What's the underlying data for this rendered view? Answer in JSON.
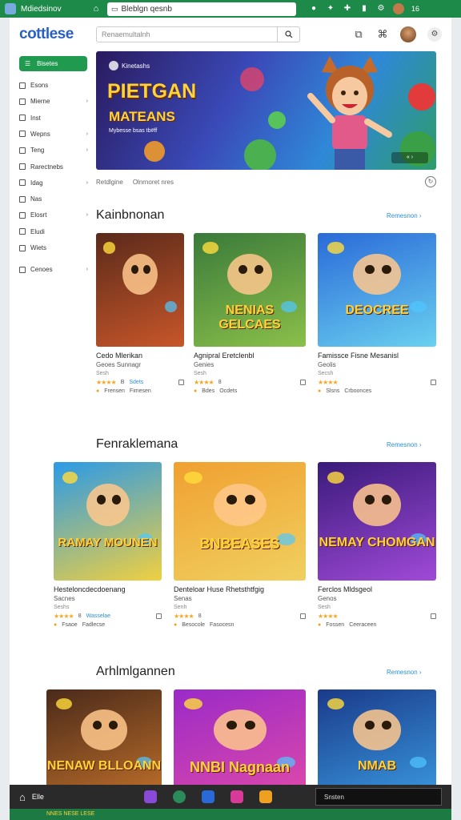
{
  "statusbar": {
    "app": "Mdiedsinov",
    "url": "Bleblgn qesnb",
    "time": "16"
  },
  "header": {
    "logo": "cottlese",
    "search_placeholder": "Renaemultalnh"
  },
  "sidebar": {
    "active": "Bisetes",
    "items": [
      {
        "label": "Esons",
        "chevron": false
      },
      {
        "label": "Mierne",
        "chevron": true
      },
      {
        "label": "Inst",
        "chevron": false
      },
      {
        "label": "Wepns",
        "chevron": true
      },
      {
        "label": "Teng",
        "chevron": true
      },
      {
        "label": "Rarectnebs",
        "chevron": false
      },
      {
        "label": "Idag",
        "chevron": true
      },
      {
        "label": "Nas",
        "chevron": false
      },
      {
        "label": "Elosrt",
        "chevron": true
      },
      {
        "label": "Eludi",
        "chevron": false
      },
      {
        "label": "Wiets",
        "chevron": false
      },
      {
        "label": "Cenoes",
        "chevron": true
      }
    ]
  },
  "hero": {
    "brand": "Kinetashs",
    "title": "PIETGAN",
    "subtitle": "MATEANS",
    "tagline": "Mybesse bsas tb#ff",
    "controls": "« ›",
    "caption_left": "Retdlgine",
    "caption_right": "Olnrnoret nres"
  },
  "sections": [
    {
      "title": "Kainbnonan",
      "link": "Remesnon ›",
      "cards": [
        {
          "title": "Cedo Mlerikan",
          "sub": "Geoes Sunnagr",
          "meta": "Sesh",
          "rating": "B",
          "extra": "Sdets",
          "foot1": "Frensen",
          "foot2": "Fimesen",
          "img_text": ""
        },
        {
          "title": "Agnipral Eretclenbl",
          "sub": "Genies",
          "meta": "Sesh",
          "rating": "8",
          "extra": "",
          "foot1": "Bdes",
          "foot2": "Ocdets",
          "img_text": "NENIAS GELCAES"
        },
        {
          "title": "Famissce Fisne Mesanisl",
          "sub": "Geolis",
          "meta": "Secsh",
          "rating": "",
          "extra": "",
          "foot1": "Slsns",
          "foot2": "Crboonces",
          "img_text": "DEOCREE"
        }
      ]
    },
    {
      "title": "Fenraklemana",
      "link": "Remesnon ›",
      "cards": [
        {
          "title": "Hesteloncdecdoenang",
          "sub": "Sacnes",
          "meta": "Seshs",
          "rating": "8",
          "extra": "Wasselae",
          "foot1": "Fsaoe",
          "foot2": "Fadlecse",
          "img_text": "RAMAY MOUNEN"
        },
        {
          "title": "Denteloar Huse Rhetsthtfgig",
          "sub": "Senas",
          "meta": "Senh",
          "rating": "8",
          "extra": "",
          "foot1": "Besocole",
          "foot2": "Fasocesn",
          "img_text": "BNBEASES"
        },
        {
          "title": "Ferclos Mldsgeol",
          "sub": "Genos",
          "meta": "Sesh",
          "rating": "",
          "extra": "",
          "foot1": "Fossen",
          "foot2": "Ceeraceen",
          "img_text": "NEMAY CHOMGAN"
        }
      ]
    },
    {
      "title": "Arhlmlgannen",
      "link": "Remesnon ›",
      "cards": [
        {
          "title": "",
          "sub": "",
          "meta": "",
          "rating": "",
          "extra": "",
          "foot1": "",
          "foot2": "",
          "img_text": "NENAW BLLOANN"
        },
        {
          "title": "",
          "sub": "",
          "meta": "",
          "rating": "",
          "extra": "",
          "foot1": "",
          "foot2": "",
          "img_text": "NNBI Nagnaan"
        },
        {
          "title": "",
          "sub": "",
          "meta": "",
          "rating": "",
          "extra": "",
          "foot1": "",
          "foot2": "",
          "img_text": "NMAB"
        }
      ]
    }
  ],
  "taskbar": {
    "label": "Elle",
    "search": "Snsten"
  },
  "footer_strip": "NNES NESE LESE"
}
